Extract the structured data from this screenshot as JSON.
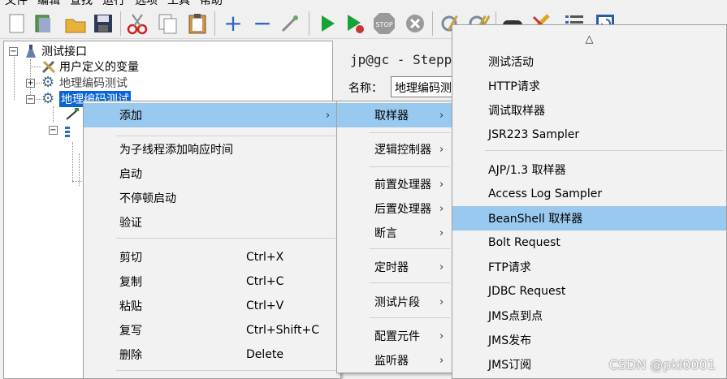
{
  "menubar": {
    "items": [
      "文件",
      "编辑",
      "查找",
      "运行",
      "选项",
      "工具",
      "帮助"
    ]
  },
  "toolbar": {
    "icons": [
      "new-icon",
      "templates-icon",
      "open-icon",
      "save-icon",
      "cut-icon",
      "copy-icon",
      "paste-icon",
      "expand-icon",
      "collapse-icon",
      "toggle-icon",
      "start-icon",
      "start-no-pause-icon",
      "stop-icon",
      "shutdown-icon",
      "clear-icon",
      "clear-all-icon",
      "search-icon",
      "reset-search-icon",
      "function-helper-icon",
      "help-icon"
    ]
  },
  "tree": {
    "root": "测试接口",
    "items": [
      {
        "label": "用户定义的变量"
      },
      {
        "label": "地理编码测试"
      },
      {
        "label": "地理编码测试"
      }
    ]
  },
  "right_pane": {
    "title": "jp@gc - Stepp",
    "name_label": "名称：",
    "name_value": "地理编码测"
  },
  "context_menu": {
    "items": [
      {
        "label": "添加",
        "shortcut": "",
        "arrow": "›"
      },
      {
        "label": "为子线程添加响应时间",
        "shortcut": ""
      },
      {
        "label": "启动",
        "shortcut": ""
      },
      {
        "label": "不停顿启动",
        "shortcut": ""
      },
      {
        "label": "验证",
        "shortcut": ""
      },
      {
        "label": "剪切",
        "shortcut": "Ctrl+X"
      },
      {
        "label": "复制",
        "shortcut": "Ctrl+C"
      },
      {
        "label": "粘贴",
        "shortcut": "Ctrl+V"
      },
      {
        "label": "复写",
        "shortcut": "Ctrl+Shift+C"
      },
      {
        "label": "删除",
        "shortcut": "Delete"
      }
    ]
  },
  "add_submenu": {
    "items": [
      {
        "label": "取样器",
        "arrow": "›"
      },
      {
        "label": "逻辑控制器",
        "arrow": "›"
      },
      {
        "label": "前置处理器",
        "arrow": "›"
      },
      {
        "label": "后置处理器",
        "arrow": "›"
      },
      {
        "label": "断言",
        "arrow": "›"
      },
      {
        "label": "定时器",
        "arrow": "›"
      },
      {
        "label": "测试片段",
        "arrow": "›"
      },
      {
        "label": "配置元件",
        "arrow": "›"
      },
      {
        "label": "监听器",
        "arrow": "›"
      }
    ]
  },
  "sampler_submenu": {
    "scroll_up": "△",
    "items": [
      {
        "label": "测试活动"
      },
      {
        "label": "HTTP请求"
      },
      {
        "label": "调试取样器"
      },
      {
        "label": "JSR223 Sampler"
      },
      {
        "label": "AJP/1.3 取样器"
      },
      {
        "label": "Access Log Sampler"
      },
      {
        "label": "BeanShell 取样器"
      },
      {
        "label": "Bolt Request"
      },
      {
        "label": "FTP请求"
      },
      {
        "label": "JDBC Request"
      },
      {
        "label": "JMS点到点"
      },
      {
        "label": "JMS发布"
      },
      {
        "label": "JMS订阅"
      }
    ]
  },
  "watermark": "CSDN @pkl0001",
  "colors": {
    "selection": "#0a64d6",
    "menu_highlight": "#99c9ef"
  }
}
